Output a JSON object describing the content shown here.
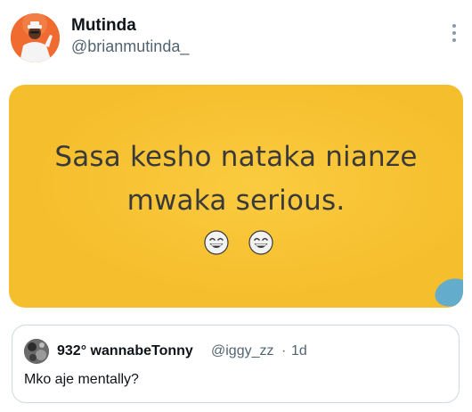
{
  "tweet": {
    "author": {
      "name": "Mutinda",
      "handle": "@brianmutinda_",
      "avatar_bg": "#ef6b2f"
    },
    "more_icon": "more-vertical-icon",
    "media": {
      "line1": "Sasa kesho nataka nianze",
      "line2": "mwaka serious.",
      "emoji": [
        "grinning-face-with-smiling-eyes",
        "grinning-face-with-smiling-eyes"
      ],
      "background": "#f5be2c"
    },
    "quote": {
      "name": "932° wannabeTonny",
      "handle": "@iggy_zz",
      "separator": "·",
      "time": "1d",
      "text": "Mko aje mentally?"
    }
  },
  "colors": {
    "text_primary": "#0f1419",
    "text_secondary": "#536471",
    "border": "#cfd9de"
  }
}
